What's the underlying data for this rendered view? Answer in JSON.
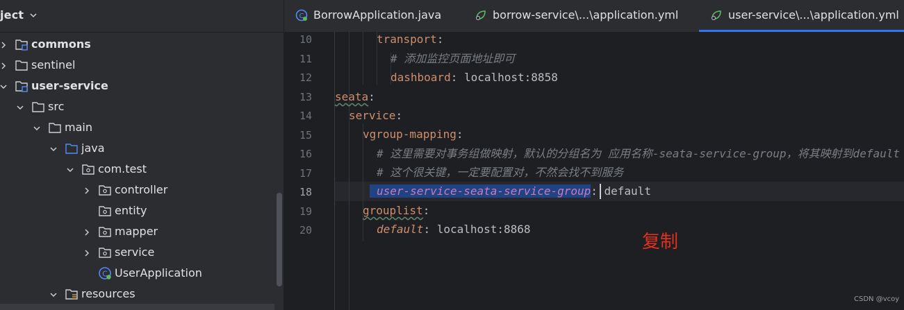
{
  "project": {
    "title": "ject",
    "tree": [
      {
        "label": "commons",
        "bold": true,
        "type": "module",
        "expanded": false
      },
      {
        "label": "sentinel",
        "bold": false,
        "type": "folder",
        "expanded": false
      },
      {
        "label": "user-service",
        "bold": true,
        "type": "module",
        "expanded": true
      },
      {
        "label": "src",
        "bold": false,
        "type": "folder",
        "expanded": true
      },
      {
        "label": "main",
        "bold": false,
        "type": "folder",
        "expanded": true
      },
      {
        "label": "java",
        "bold": false,
        "type": "source-folder",
        "expanded": true
      },
      {
        "label": "com.test",
        "bold": false,
        "type": "package",
        "expanded": true
      },
      {
        "label": "controller",
        "bold": false,
        "type": "package",
        "expanded": false
      },
      {
        "label": "entity",
        "bold": false,
        "type": "package",
        "expanded": null
      },
      {
        "label": "mapper",
        "bold": false,
        "type": "package",
        "expanded": false
      },
      {
        "label": "service",
        "bold": false,
        "type": "package",
        "expanded": false
      },
      {
        "label": "UserApplication",
        "bold": false,
        "type": "spring-class",
        "expanded": null
      },
      {
        "label": "resources",
        "bold": false,
        "type": "resources-folder",
        "expanded": true
      }
    ]
  },
  "tabs": [
    {
      "label": "BorrowApplication.java",
      "icon": "spring-class-icon",
      "active": false
    },
    {
      "label": "borrow-service\\...\\application.yml",
      "icon": "spring-yml-icon",
      "active": false
    },
    {
      "label": "user-service\\...\\application.yml",
      "icon": "spring-yml-icon",
      "active": true
    }
  ],
  "editor": {
    "line_numbers": [
      "10",
      "11",
      "12",
      "13",
      "14",
      "15",
      "16",
      "17",
      "18",
      "19",
      "20"
    ],
    "current_line": "18",
    "lines": {
      "l10_key": "transport",
      "l11_comment": "# 添加监控页面地址即可",
      "l12_key": "dashboard",
      "l12_value": "localhost:8858",
      "l13_key": "seata",
      "l14_key": "service",
      "l15_key": "vgroup-mapping",
      "l16_comment": "# 这里需要对事务组做映射，默认的分组名为 应用名称-seata-service-group，将其映射到default",
      "l17_comment": "# 这个很关键，一定要配置对，不然会找不到服务",
      "l18_key_selected": "user-service-seata-service-group",
      "l18_value": "default",
      "l19_key": "grouplist",
      "l20_key": "default",
      "l20_value": "localhost:8868"
    }
  },
  "annotation": "复制",
  "watermark": "CSDN @vcoy",
  "colors": {
    "background": "#1e1f22",
    "panel": "#2b2d30",
    "yaml_key": "#cf8e6d",
    "comment": "#7a7e85",
    "selection": "#214283",
    "active_tab_underline": "#3574f0",
    "annotation_red": "#e0301e"
  }
}
